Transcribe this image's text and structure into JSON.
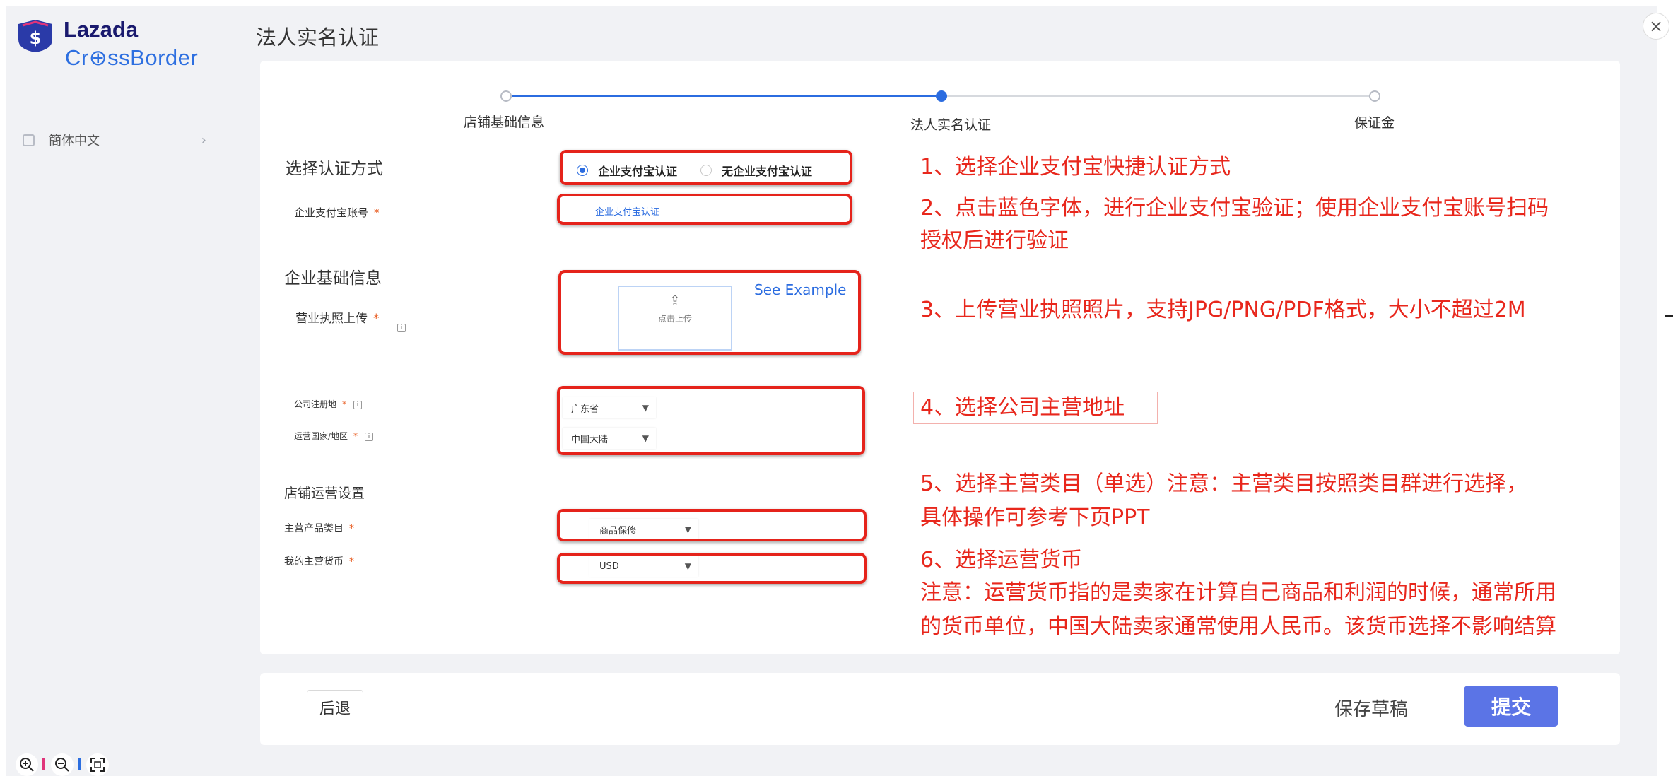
{
  "logo": {
    "line1": "Lazada",
    "line2": "Cr⊕ssBorder",
    "brand_color": "#1a1a6e",
    "accent_color": "#2d6fe0"
  },
  "sidebar": {
    "language": "簡体中文",
    "chevron": "›"
  },
  "page_title": "法人实名认证",
  "close_icon": "×",
  "stepper": {
    "steps": [
      {
        "label": "店铺基础信息",
        "state": "todo"
      },
      {
        "label": "法人实名认证",
        "state": "current"
      },
      {
        "label": "保证金",
        "state": "todo"
      }
    ]
  },
  "form": {
    "auth_section_title": "选择认证方式",
    "auth_options": [
      {
        "label": "企业支付宝认证",
        "selected": true
      },
      {
        "label": "无企业支付宝认证",
        "selected": false
      }
    ],
    "alipay_account_label": "企业支付宝账号",
    "alipay_link": "企业支付宝认证",
    "company_section_title": "企业基础信息",
    "license_label": "营业执照上传",
    "upload_icon": "upload-icon",
    "upload_text": "点击上传",
    "see_example": "See Example",
    "reg_place_label": "公司注册地",
    "reg_place_value": "广东省",
    "op_country_label": "运营国家/地区",
    "op_country_value": "中国大陆",
    "store_section_title": "店铺运营设置",
    "category_label": "主营产品类目",
    "category_value": "商品保修",
    "currency_label": "我的主营货币",
    "currency_value": "USD",
    "required_mark": "*"
  },
  "annotations": {
    "a1": "1、选择企业支付宝快捷认证方式",
    "a2_line1": "2、点击蓝色字体，进行企业支付宝验证；使用企业支付宝账号扫码",
    "a2_line2": "授权后进行验证",
    "a3": "3、上传营业执照照片，支持JPG/PNG/PDF格式，大小不超过2M",
    "a4": "4、选择公司主营地址",
    "a5_line1": "5、选择主营类目（单选）注意：主营类目按照类目群进行选择，",
    "a5_line2": "具体操作可参考下页PPT",
    "a6_line1": "6、选择运营货币",
    "a6_line2": "注意：运营货币指的是卖家在计算自己商品和利润的时候，通常所用",
    "a6_line3": "的货币单位，中国大陆卖家通常使用人民币。该货币选择不影响结算",
    "color": "#e8271c"
  },
  "footer": {
    "back": "后退",
    "save_draft": "保存草稿",
    "submit": "提交",
    "submit_color": "#5b74e6"
  },
  "zoom_controls": {
    "zoom_in": "zoom-in-icon",
    "zoom_out": "zoom-out-icon",
    "fit": "fit-screen-icon"
  }
}
